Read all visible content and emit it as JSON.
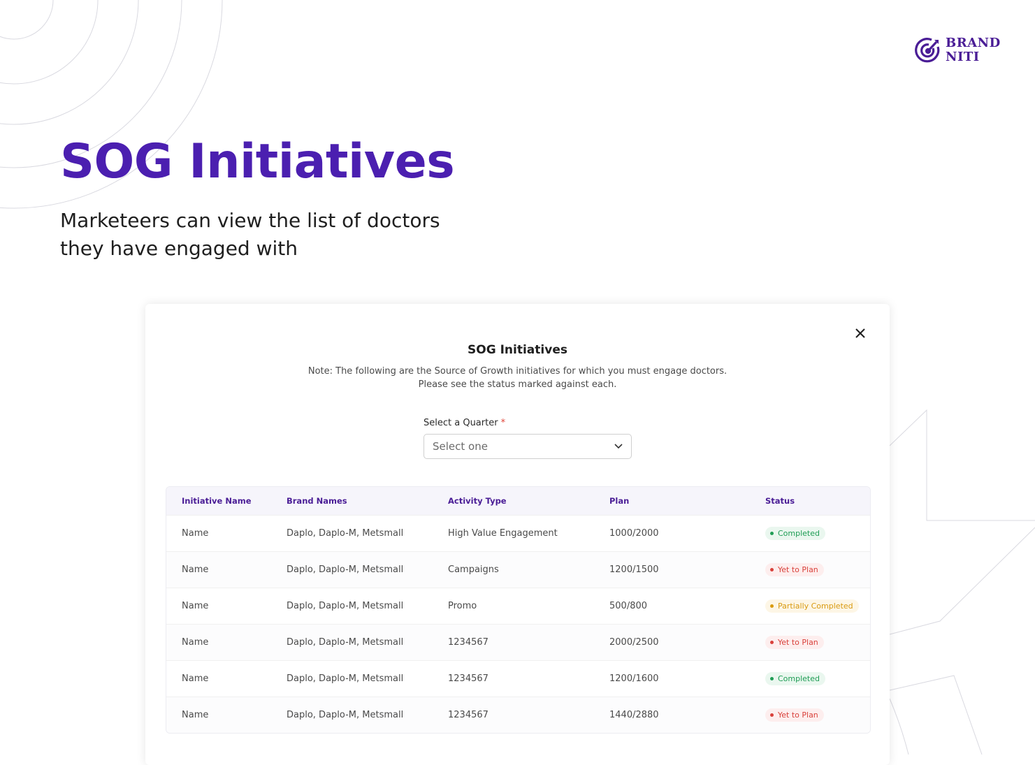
{
  "brand": {
    "line1": "BRAND",
    "line2": "NITI",
    "icon": "target-icon",
    "color": "#4a1d96"
  },
  "hero": {
    "title": "SOG Initiatives",
    "subtitle": "Marketeers can view the list of doctors they have engaged with"
  },
  "modal": {
    "title": "SOG Initiatives",
    "note_line1": "Note: The following are the Source of Growth initiatives for which you must engage doctors.",
    "note_line2": "Please see the status marked against each.",
    "quarter_label": "Select a Quarter",
    "required_mark": "*",
    "quarter_placeholder": "Select one",
    "close_icon": "close-icon"
  },
  "table": {
    "headers": [
      "Initiative Name",
      "Brand Names",
      "Activity Type",
      "Plan",
      "Status"
    ],
    "rows": [
      {
        "name": "Name",
        "brands": "Daplo, Daplo-M, Metsmall",
        "activity": "High Value Engagement",
        "plan": "1000/2000",
        "status": "Completed",
        "status_type": "completed"
      },
      {
        "name": "Name",
        "brands": "Daplo, Daplo-M, Metsmall",
        "activity": "Campaigns",
        "plan": "1200/1500",
        "status": "Yet to Plan",
        "status_type": "yet"
      },
      {
        "name": "Name",
        "brands": "Daplo, Daplo-M, Metsmall",
        "activity": "Promo",
        "plan": "500/800",
        "status": "Partially Completed",
        "status_type": "partial"
      },
      {
        "name": "Name",
        "brands": "Daplo, Daplo-M, Metsmall",
        "activity": "1234567",
        "plan": "2000/2500",
        "status": "Yet to Plan",
        "status_type": "yet"
      },
      {
        "name": "Name",
        "brands": "Daplo, Daplo-M, Metsmall",
        "activity": "1234567",
        "plan": "1200/1600",
        "status": "Completed",
        "status_type": "completed"
      },
      {
        "name": "Name",
        "brands": "Daplo, Daplo-M, Metsmall",
        "activity": "1234567",
        "plan": "1440/2880",
        "status": "Yet to Plan",
        "status_type": "yet"
      }
    ]
  },
  "colors": {
    "accent": "#4b1fb0",
    "completed": "#1f9d55",
    "yet_to_plan": "#d9413b",
    "partial": "#d99a10"
  }
}
